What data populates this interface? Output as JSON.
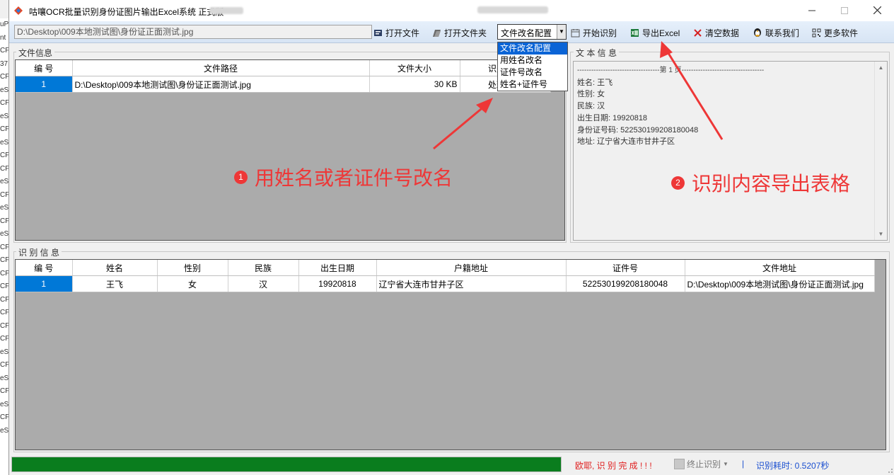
{
  "app": {
    "title": "咕嚷OCR批量识别身份证图片输出Excel系统 正式版"
  },
  "toolbar": {
    "path_value": "D:\\Desktop\\009本地测试图\\身份证正面测试.jpg",
    "open_file": "打开文件",
    "open_folder": "打开文件夹",
    "rename_select_value": "文件改名配置",
    "start": "开始识别",
    "export": "导出Excel",
    "clear": "清空数据",
    "contact": "联系我们",
    "more": "更多软件"
  },
  "rename_options": [
    "文件改名配置",
    "用姓名改名",
    "证件号改名",
    "姓名+证件号"
  ],
  "file_info": {
    "label": "文件信息",
    "headers": [
      "编 号",
      "文件路径",
      "文件大小",
      "识别状态"
    ],
    "rows": [
      {
        "no": "1",
        "path": "D:\\Desktop\\009本地测试图\\身份证正面测试.jpg",
        "size": "30 KB",
        "status": "处理完成"
      }
    ]
  },
  "text_info": {
    "label": "文 本 信 息",
    "page_header": "-----------------------------------第 1 页-----------------------------------",
    "lines": [
      "姓名:  王飞",
      "性别:  女",
      "民族:  汉",
      "出生日期:  19920818",
      "身份证号码:  522530199208180048",
      "地址:  辽宁省大连市甘井子区"
    ]
  },
  "recog_info": {
    "label": "识 别 信 息",
    "headers": [
      "编 号",
      "姓名",
      "性别",
      "民族",
      "出生日期",
      "户籍地址",
      "证件号",
      "文件地址"
    ],
    "rows": [
      {
        "no": "1",
        "name": "王飞",
        "gender": "女",
        "ethnicity": "汉",
        "birth": "19920818",
        "address": "辽宁省大连市甘井子区",
        "id": "522530199208180048",
        "file": "D:\\Desktop\\009本地测试图\\身份证正面测试.jpg"
      }
    ]
  },
  "annotations": {
    "a1_num": "1",
    "a1_text": "用姓名或者证件号改名",
    "a2_num": "2",
    "a2_text": "识别内容导出表格",
    "color": "#ee3737"
  },
  "status": {
    "progress_fraction": 1.0,
    "message": "欧耶, 识 别 完 成 ! ! !",
    "stop": "终止识别",
    "separator": "|",
    "elapsed": "识别耗时: 0.5207秒"
  }
}
